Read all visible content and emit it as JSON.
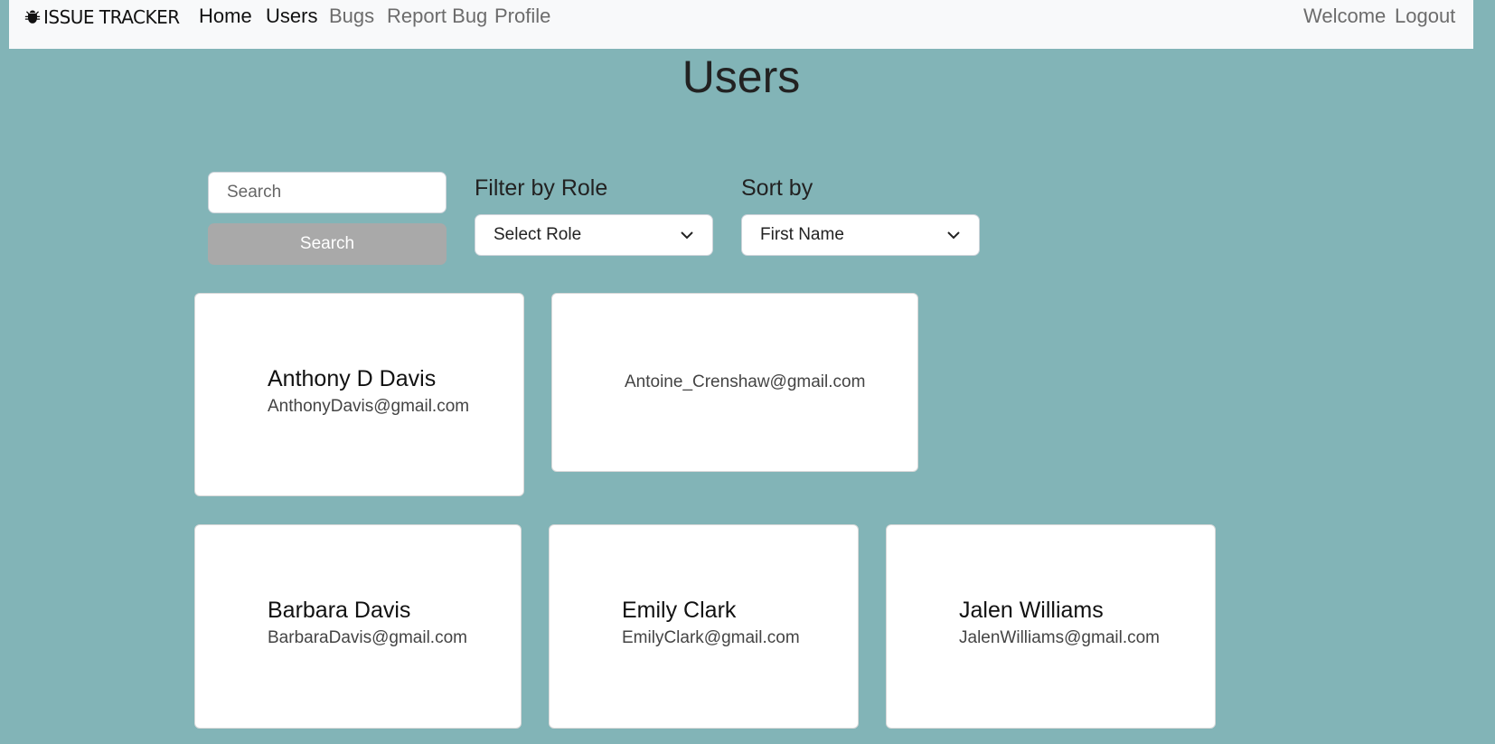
{
  "navbar": {
    "brand": "ISSUE TRACKER",
    "links": [
      "Home",
      "Users",
      "Bugs",
      "Report Bug",
      "Profile"
    ],
    "right_links": [
      "Welcome",
      "Logout"
    ]
  },
  "page": {
    "title": "Users"
  },
  "search": {
    "placeholder": "Search",
    "button_label": "Search"
  },
  "filters": {
    "role_label": "Filter by Role",
    "role_value": "Select Role",
    "sort_label": "Sort by",
    "sort_value": "First Name"
  },
  "users": [
    {
      "name": "Anthony D Davis",
      "email": "AnthonyDavis@gmail.com"
    },
    {
      "name": "",
      "email": "Antoine_Crenshaw@gmail.com"
    },
    {
      "name": "Barbara Davis",
      "email": "BarbaraDavis@gmail.com"
    },
    {
      "name": "Emily Clark",
      "email": "EmilyClark@gmail.com"
    },
    {
      "name": "Jalen Williams",
      "email": "JalenWilliams@gmail.com"
    }
  ]
}
